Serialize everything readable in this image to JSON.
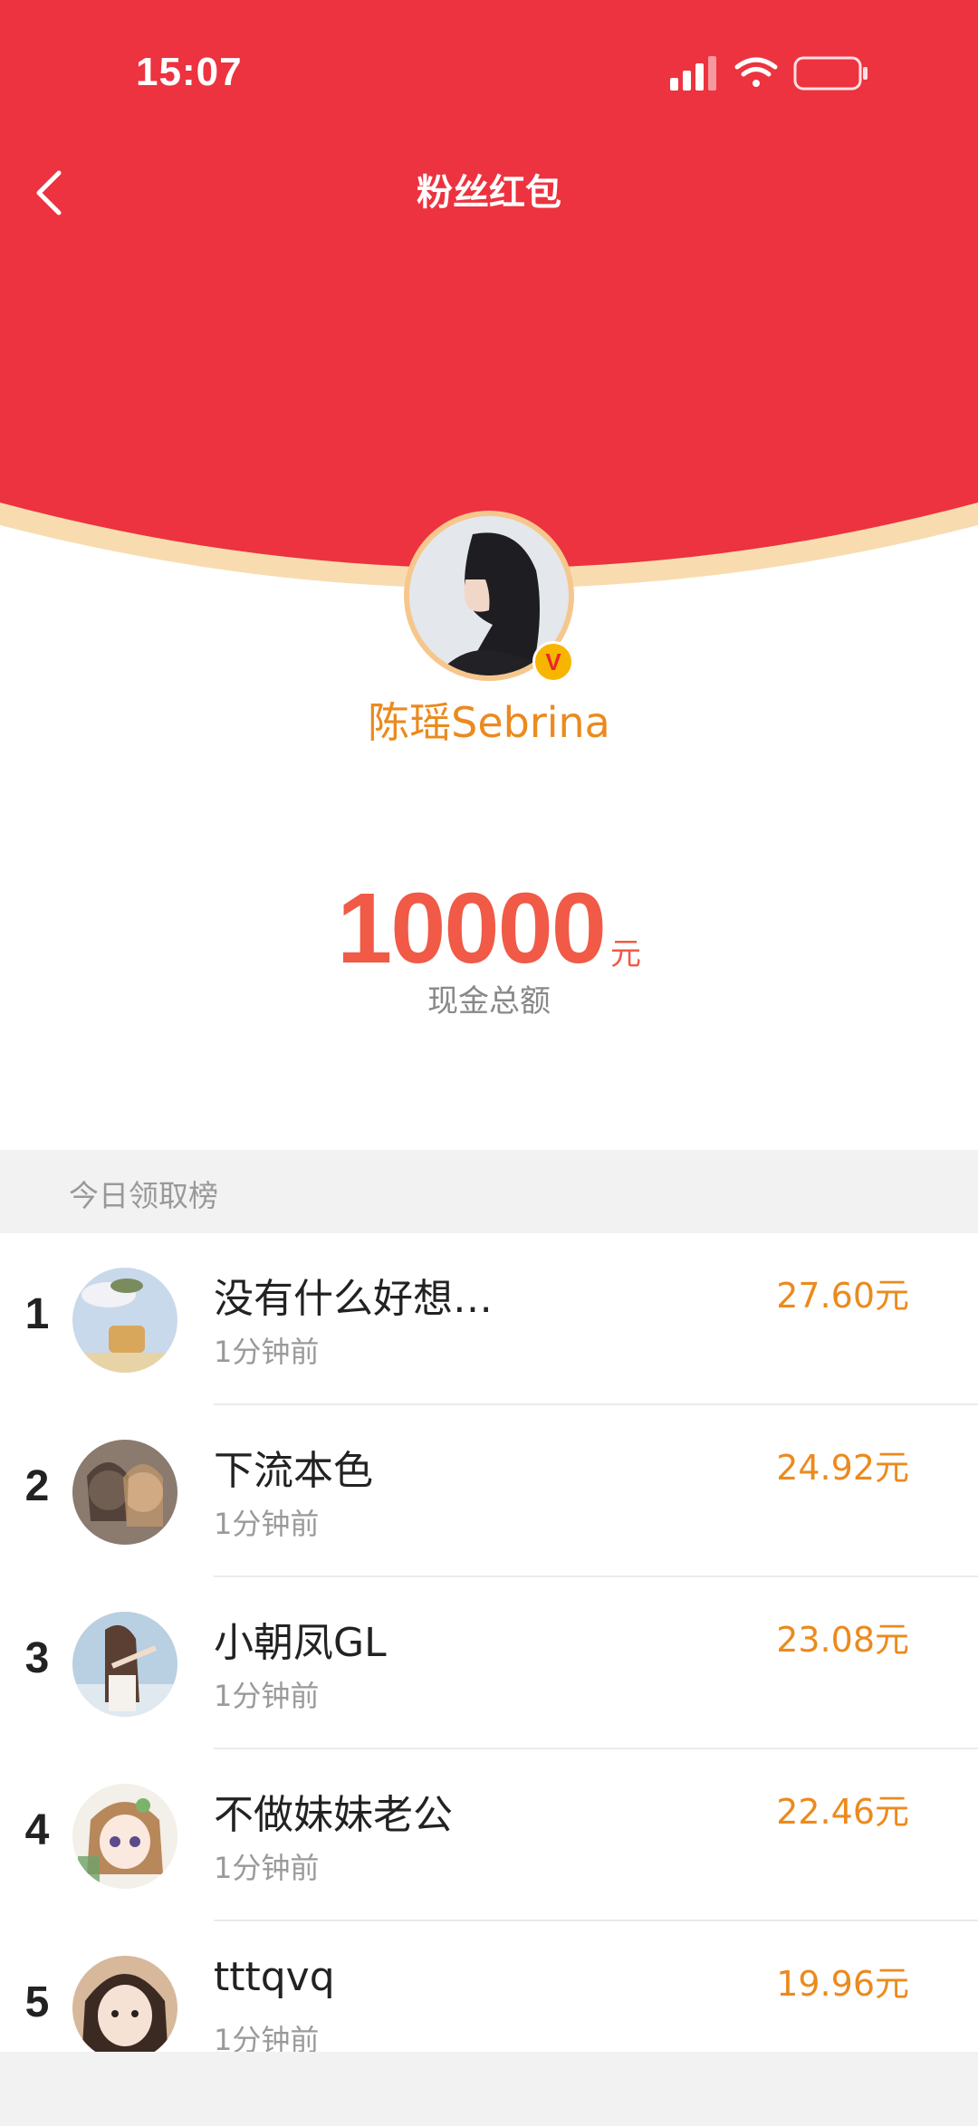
{
  "status_bar": {
    "time": "15:07"
  },
  "nav": {
    "title": "粉丝红包"
  },
  "profile": {
    "name": "陈瑶Sebrina",
    "verified_label": "V"
  },
  "summary": {
    "amount": "10000",
    "unit": "元",
    "caption": "现金总额"
  },
  "leaderboard": {
    "title": "今日领取榜",
    "rows": [
      {
        "rank": "1",
        "name": "没有什么好想…",
        "time": "1分钟前",
        "amount": "27.60元"
      },
      {
        "rank": "2",
        "name": "下流本色",
        "time": "1分钟前",
        "amount": "24.92元"
      },
      {
        "rank": "3",
        "name": "小朝凤GL",
        "time": "1分钟前",
        "amount": "23.08元"
      },
      {
        "rank": "4",
        "name": "不做妹妹老公",
        "time": "1分钟前",
        "amount": "22.46元"
      },
      {
        "rank": "5",
        "name": "tttqvq",
        "time": "1分钟前",
        "amount": "19.96元"
      }
    ]
  },
  "colors": {
    "header_red": "#ec333f",
    "accent_orange": "#eb8a1e",
    "amount_red": "#f05a47"
  },
  "icons": {
    "back": "chevron-left-icon",
    "signal": "signal-icon",
    "wifi": "wifi-icon",
    "battery": "battery-icon",
    "verified": "verified-icon"
  }
}
